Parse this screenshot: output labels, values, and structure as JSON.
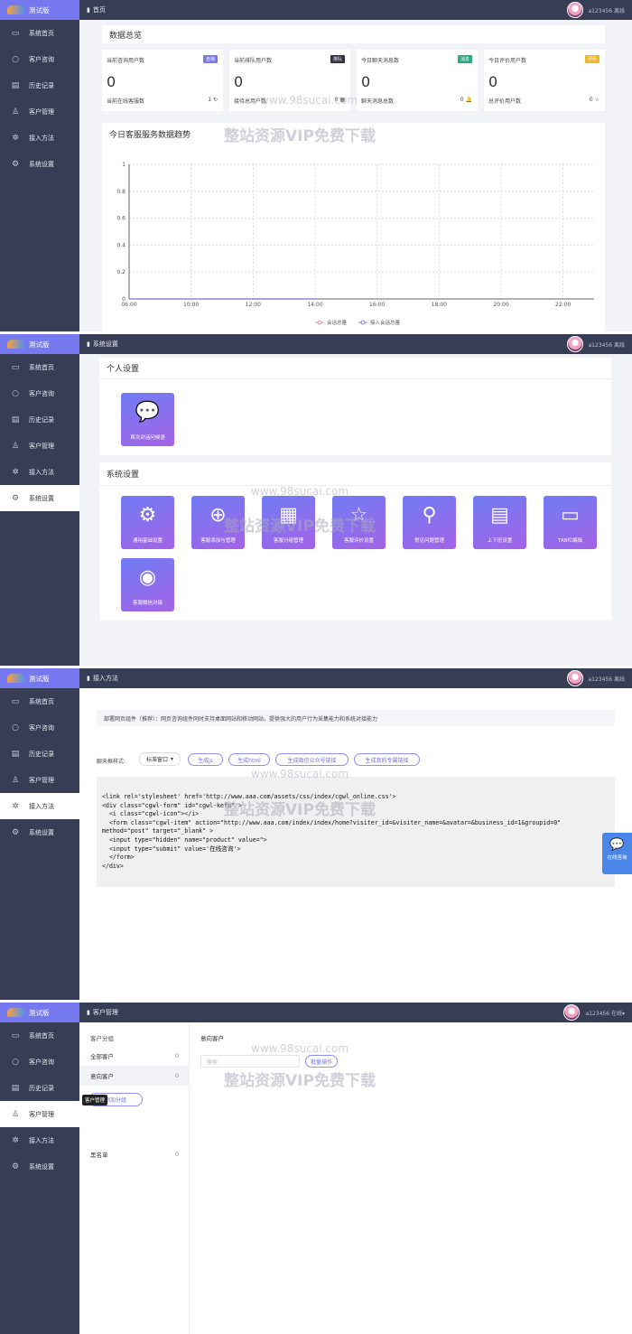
{
  "sidebar": {
    "logo_text": "测试版",
    "items": [
      "系统首页",
      "客户咨询",
      "历史记录",
      "客户管理",
      "接入方法",
      "系统设置"
    ]
  },
  "user": {
    "name_offline": "a123456 离线",
    "name_online": "a123456 在线▾"
  },
  "watermark": {
    "url": "www.98sucai.com",
    "text": "整站资源VIP免费下载"
  },
  "home": {
    "breadcrumb": "首页",
    "overview_title": "数据总览",
    "stats": [
      {
        "label": "当前咨询用户数",
        "tag": "咨询",
        "tag_color": "#7b7be8",
        "value": "0",
        "sub_label": "当前在线客服数",
        "sub_value": "1",
        "icon": "refresh-icon"
      },
      {
        "label": "当前排队用户数",
        "tag": "排队",
        "tag_color": "#2f3447",
        "value": "0",
        "sub_label": "接待总用户数",
        "sub_value": "0",
        "icon": "grid-icon"
      },
      {
        "label": "今日聊天消息数",
        "tag": "消息",
        "tag_color": "#2aa985",
        "value": "0",
        "sub_label": "聊天消息总数",
        "sub_value": "0",
        "icon": "bell-icon"
      },
      {
        "label": "今日评价用户数",
        "tag": "评价",
        "tag_color": "#f1b626",
        "value": "0",
        "sub_label": "总评价用户数",
        "sub_value": "0",
        "icon": "star-icon"
      }
    ],
    "trend_title": "今日客服服务数据趋势",
    "legend": [
      "会话总量",
      "接入会话总量"
    ]
  },
  "chart_data": {
    "type": "line",
    "title": "今日客服服务数据趋势",
    "x": [
      "06:00",
      "10:00",
      "12:00",
      "14:00",
      "16:00",
      "18:00",
      "20:00",
      "22:00"
    ],
    "ylim": [
      0,
      1
    ],
    "yticks": [
      "0",
      "0.2",
      "0.4",
      "0.6",
      "0.8",
      "1"
    ],
    "series": [
      {
        "name": "会话总量",
        "values": [
          0,
          0,
          0,
          0
        ],
        "color": "#e88b8b"
      },
      {
        "name": "接入会话总量",
        "values": [
          0,
          0,
          0,
          0
        ],
        "color": "#7c7fe6"
      }
    ],
    "grid": true,
    "legend_position": "bottom"
  },
  "settings": {
    "breadcrumb": "系统设置",
    "personal_title": "个人设置",
    "personal_tiles": [
      {
        "label": "首次对话问候语",
        "icon": "chat-icon"
      }
    ],
    "system_title": "系统设置",
    "system_tiles": [
      {
        "label": "通用基础设置",
        "icon": "gear-icon",
        "glyph": "⚙"
      },
      {
        "label": "客服添加与管理",
        "icon": "plus-circle-icon",
        "glyph": "⊕"
      },
      {
        "label": "客服分组管理",
        "icon": "group-grid-icon",
        "glyph": "▦"
      },
      {
        "label": "客服评价设置",
        "icon": "star-icon",
        "glyph": "☆"
      },
      {
        "label": "常见问题管理",
        "icon": "search-icon",
        "glyph": "⚲"
      },
      {
        "label": "上下班设置",
        "icon": "calendar-icon",
        "glyph": "▤"
      },
      {
        "label": "TAB栏编辑",
        "icon": "window-icon",
        "glyph": "▭"
      },
      {
        "label": "客服微信对接",
        "icon": "wechat-icon",
        "glyph": "◉"
      }
    ]
  },
  "access": {
    "breadcrumb": "接入方法",
    "notice": "部署网页组件（推荐）：网页咨询组件同时支持桌面网站和移动网站，提供强大的用户行为采集能力和系统对接能力",
    "style_label": "聊天框样式:",
    "style_value": "标准窗口",
    "buttons": [
      "生成js",
      "生成html",
      "生成微信公众号链接",
      "生成我的专属链接"
    ],
    "code_lines": [
      "<link rel='stylesheet' href='http://www.aaa.com/assets/css/index/cgwl_online.css'>",
      "<div class=\"cgwl-form\" id=\"cgwl-kefu\" >",
      "  <i class=\"cgwl-icon\"></i>",
      "  <form class=\"cgwl-item\" action=\"http://www.aaa.com/index/index/home?visiter_id=&visiter_name=&avatar=&business_id=1&groupid=0\"",
      "method=\"post\" target=\"_blank\" >",
      "  <input type=\"hidden\" name=\"product\" value=\">",
      "  <input type=\"submit\" value='在线咨询'>",
      "  </form>",
      "</div>"
    ],
    "float_label": "在线咨询"
  },
  "customers": {
    "breadcrumb": "客户管理",
    "group_title": "客户分组",
    "groups": [
      {
        "name": "全部客户",
        "count": "0"
      },
      {
        "name": "意向客户",
        "count": "0"
      }
    ],
    "add_group_button": "添加分组",
    "blacklist": {
      "name": "黑名单",
      "count": "0"
    },
    "tooltip": "客户管理",
    "content_title": "意向客户",
    "search_placeholder": "搜索",
    "batch_button": "批量操作"
  }
}
